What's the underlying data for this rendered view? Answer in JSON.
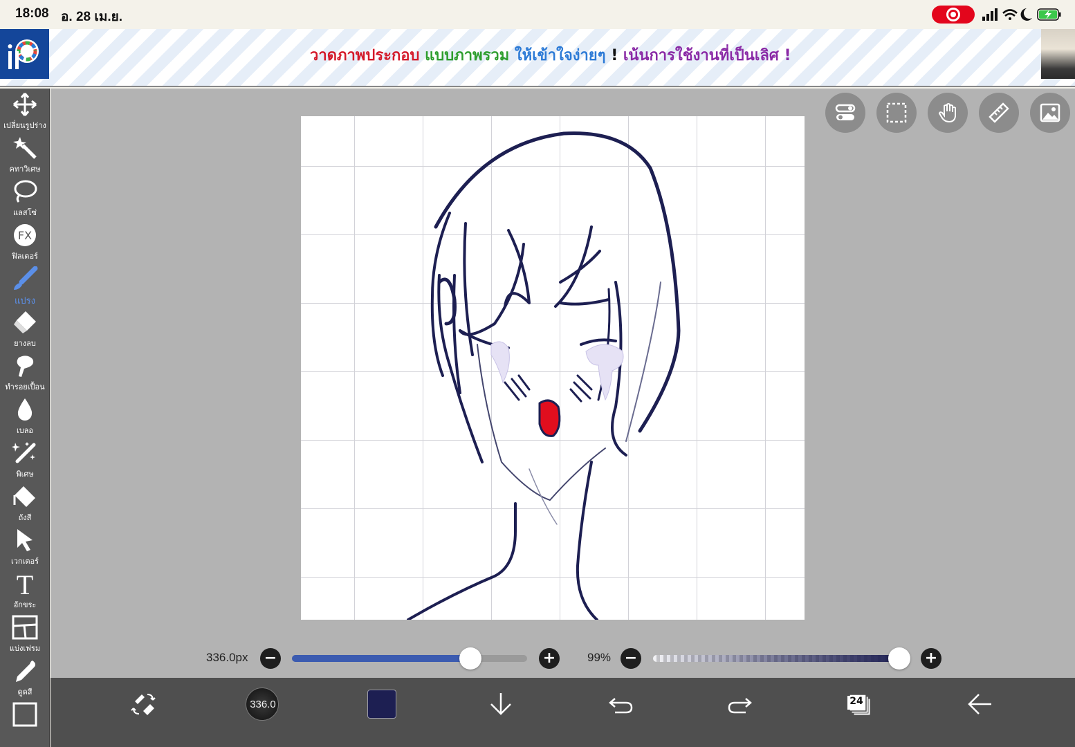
{
  "status_bar": {
    "time": "18:08",
    "date": "อ. 28 เม.ย.",
    "recording_color": "#e3061c",
    "icons": [
      "signal-icon",
      "wifi-icon",
      "moon-icon",
      "battery-charging-icon"
    ]
  },
  "banner": {
    "logo_icon": "ibispaint-logo",
    "text_segments": [
      "วาดภาพประกอบ ",
      "แบบภาพรวม ",
      "ให้เข้าใจง่ายๆ ",
      "! ",
      "เน้นการใช้งานที่เป็นเลิศ !"
    ]
  },
  "tools": [
    {
      "label": "เปลี่ยนรูปร่าง",
      "icon": "move-arrows-icon"
    },
    {
      "label": "คทาวิเศษ",
      "icon": "magic-wand-icon"
    },
    {
      "label": "แลสโซ่",
      "icon": "lasso-icon"
    },
    {
      "label": "ฟิลเตอร์",
      "icon": "fx-filter-icon"
    },
    {
      "label": "แปรง",
      "icon": "brush-icon",
      "active": true
    },
    {
      "label": "ยางลบ",
      "icon": "eraser-icon"
    },
    {
      "label": "ทำรอยเปื้อน",
      "icon": "smudge-icon"
    },
    {
      "label": "เบลอ",
      "icon": "blur-drop-icon"
    },
    {
      "label": "พิเศษ",
      "icon": "special-pen-icon"
    },
    {
      "label": "ถังสี",
      "icon": "paint-bucket-icon"
    },
    {
      "label": "เวกเตอร์",
      "icon": "vector-cursor-icon"
    },
    {
      "label": "อักขระ",
      "icon": "text-icon"
    },
    {
      "label": "แบ่งเฟรม",
      "icon": "frame-divider-icon"
    },
    {
      "label": "ดูดสี",
      "icon": "eyedropper-icon"
    }
  ],
  "canvas_toggles": [
    "toggle-icon",
    "selection-icon",
    "hand-icon",
    "ruler-icon",
    "image-icon"
  ],
  "brush": {
    "size_label": "336.0px",
    "size_fraction": 0.76,
    "opacity_label": "99%",
    "opacity_fraction": 0.99,
    "preview_label": "336.0",
    "color": "#1d1f52"
  },
  "bottom_bar": {
    "layer_count": "24",
    "icons": [
      "swap-tool-icon",
      "brush-preview",
      "color-swatch",
      "down-arrow-icon",
      "undo-icon",
      "redo-icon",
      "layers-icon",
      "back-arrow-icon"
    ]
  }
}
